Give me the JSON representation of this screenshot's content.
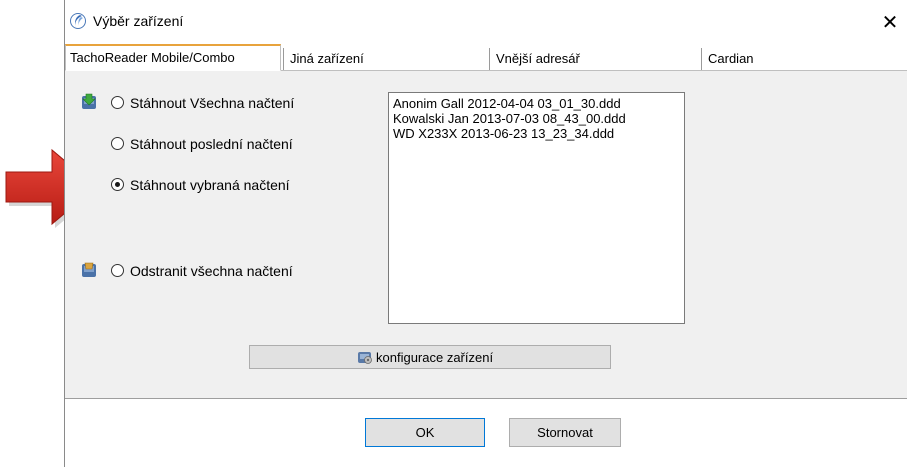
{
  "window": {
    "title": "Výběr zařízení",
    "close_glyph": "✕"
  },
  "tabs": [
    {
      "label": "TachoReader Mobile/Combo",
      "active": true
    },
    {
      "label": "Jiná zařízení",
      "active": false
    },
    {
      "label": "Vnější adresář",
      "active": false
    },
    {
      "label": "Cardian",
      "active": false
    }
  ],
  "options": {
    "download_all": "Stáhnout Všechna načtení",
    "download_last": "Stáhnout poslední načtení",
    "download_selected": "Stáhnout vybraná načtení",
    "delete_all": "Odstranit všechna načtení",
    "selected": "download_selected"
  },
  "files": [
    "Anonim Gall 2012-04-04 03_01_30.ddd",
    "Kowalski Jan 2013-07-03 08_43_00.ddd",
    "WD X233X 2013-06-23 13_23_34.ddd"
  ],
  "buttons": {
    "config": "konfigurace zařízení",
    "ok": "OK",
    "cancel": "Stornovat"
  },
  "colors": {
    "arrow": "#d42a20",
    "tab_accent": "#e8a33c",
    "default_button_border": "#0078d7"
  },
  "icons": {
    "window": "app-logo-icon",
    "download": "download-card-icon",
    "delete": "delete-card-icon",
    "config": "device-config-icon",
    "pointer": "red-arrow-icon"
  }
}
